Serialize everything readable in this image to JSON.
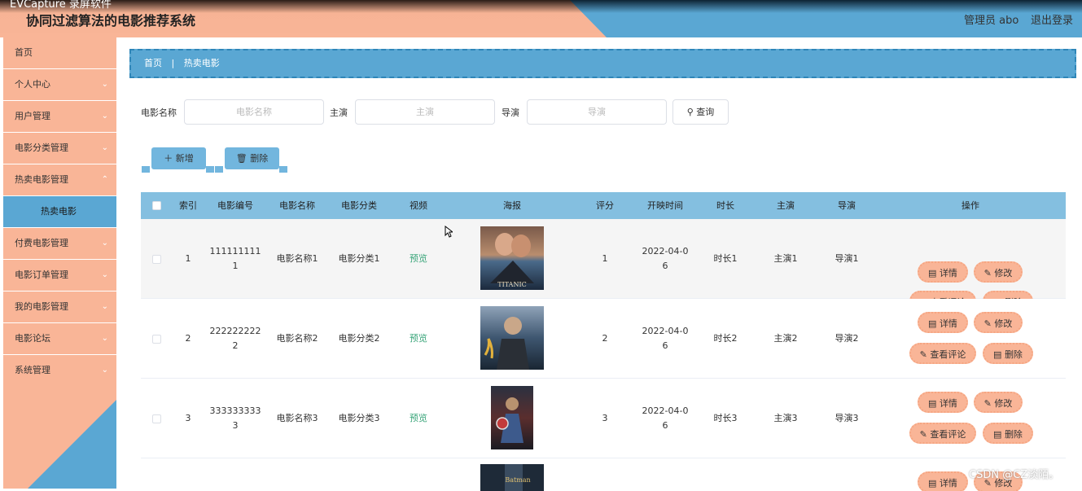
{
  "header": {
    "window_caption": "EVCapture 录屏软件",
    "title": "协同过滤算法的电影推荐系统",
    "user": "管理员 abo",
    "logout": "退出登录"
  },
  "sidebar": {
    "items": [
      {
        "label": "首页",
        "chevron": false
      },
      {
        "label": "个人中心",
        "chevron": true
      },
      {
        "label": "用户管理",
        "chevron": true
      },
      {
        "label": "电影分类管理",
        "chevron": true
      },
      {
        "label": "热卖电影管理",
        "chevron": true
      },
      {
        "label": "热卖电影",
        "sub": true
      },
      {
        "label": "付费电影管理",
        "chevron": true
      },
      {
        "label": "电影订单管理",
        "chevron": true
      },
      {
        "label": "我的电影管理",
        "chevron": true
      },
      {
        "label": "电影论坛",
        "chevron": true
      },
      {
        "label": "系统管理",
        "chevron": true
      }
    ]
  },
  "breadcrumb": {
    "home": "首页",
    "separator": "|",
    "current": "热卖电影"
  },
  "search": {
    "movie_name_label": "电影名称",
    "movie_name_placeholder": "电影名称",
    "actor_label": "主演",
    "actor_placeholder": "主演",
    "director_label": "导演",
    "director_placeholder": "导演",
    "query_button": "查询"
  },
  "actions": {
    "add": "新增",
    "delete": "删除"
  },
  "table": {
    "headers": [
      "索引",
      "电影编号",
      "电影名称",
      "电影分类",
      "视频",
      "海报",
      "评分",
      "开映时间",
      "时长",
      "主演",
      "导演",
      "操作"
    ],
    "rows": [
      {
        "index": "1",
        "id_line1": "111111111",
        "id_line2": "1",
        "name": "电影名称1",
        "category": "电影分类1",
        "video": "预览",
        "poster": "titanic",
        "poster_text": "TITANIC",
        "rating": "1",
        "date_line1": "2022-04-0",
        "date_line2": "6",
        "duration": "时长1",
        "actor": "主演1",
        "director": "导演1"
      },
      {
        "index": "2",
        "id_line1": "222222222",
        "id_line2": "2",
        "name": "电影名称2",
        "category": "电影分类2",
        "video": "预览",
        "poster": "storm",
        "rating": "2",
        "date_line1": "2022-04-0",
        "date_line2": "6",
        "duration": "时长2",
        "actor": "主演2",
        "director": "导演2"
      },
      {
        "index": "3",
        "id_line1": "333333333",
        "id_line2": "3",
        "name": "电影名称3",
        "category": "电影分类3",
        "video": "预览",
        "poster": "hero",
        "rating": "3",
        "date_line1": "2022-04-0",
        "date_line2": "6",
        "duration": "时长3",
        "actor": "主演3",
        "director": "导演3"
      }
    ],
    "partial_row": {
      "poster_text": "Batman"
    },
    "ops": {
      "detail": "详情",
      "edit": "修改",
      "review": "查看评论",
      "delete": "删除"
    }
  },
  "watermark": "CSDN @CZ淡陌。",
  "colors": {
    "salmon": "#f9b597",
    "blue": "#5aa7d3",
    "header_blue": "#84bfe0",
    "preview_green": "#3aa57a"
  }
}
